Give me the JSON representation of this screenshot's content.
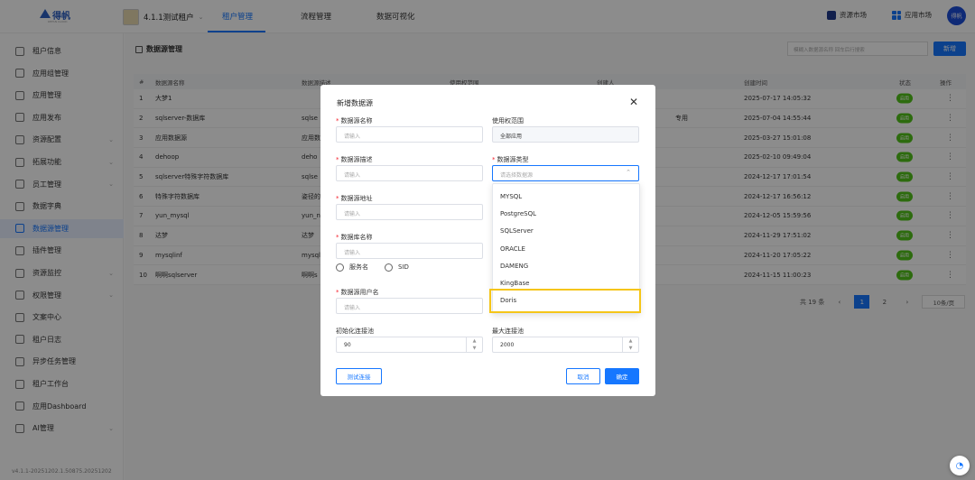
{
  "brand": {
    "name": "得帆",
    "sub": "DEFAN CLOUD",
    "color": "#2d5fc4"
  },
  "tenant": {
    "name": "4.1.1测试租户"
  },
  "nav": [
    "租户管理",
    "流程管理",
    "数据可视化"
  ],
  "topright": {
    "resource_market": "资源市场",
    "app_market": "应用市场",
    "user": "得帆"
  },
  "sidebar": [
    {
      "label": "租户信息",
      "icon": "building-icon"
    },
    {
      "label": "应用组管理",
      "icon": "org-icon"
    },
    {
      "label": "应用管理",
      "icon": "app-icon"
    },
    {
      "label": "应用发布",
      "icon": "publish-icon"
    },
    {
      "label": "资源配置",
      "icon": "folder-icon",
      "chevron": "⌄"
    },
    {
      "label": "拓展功能",
      "icon": "folder-icon",
      "chevron": "⌄"
    },
    {
      "label": "员工管理",
      "icon": "user-icon",
      "chevron": "⌄"
    },
    {
      "label": "数据字典",
      "icon": "book-icon"
    },
    {
      "label": "数据源管理",
      "icon": "database-icon",
      "active": true
    },
    {
      "label": "插件管理",
      "icon": "plugin-icon"
    },
    {
      "label": "资源监控",
      "icon": "folder-icon",
      "chevron": "⌄"
    },
    {
      "label": "权限管理",
      "icon": "shield-icon",
      "chevron": "⌄"
    },
    {
      "label": "文案中心",
      "icon": "globe-icon"
    },
    {
      "label": "租户日志",
      "icon": "log-icon"
    },
    {
      "label": "异步任务管理",
      "icon": "task-icon"
    },
    {
      "label": "租户工作台",
      "icon": "workbench-icon"
    },
    {
      "label": "应用Dashboard",
      "icon": "dashboard-icon"
    },
    {
      "label": "AI管理",
      "icon": "ai-icon",
      "chevron": "⌄"
    }
  ],
  "version": "v4.1.1-20251202.1.50875.20251202",
  "page": {
    "title": "数据源管理",
    "search_placeholder": "模糊入数据源名称  回车后行搜索",
    "new_btn": "新增"
  },
  "table": {
    "headers": [
      "#",
      "数据源名称",
      "数据源描述",
      "使用权范围",
      "创建人",
      "创建时间",
      "状态",
      "操作"
    ],
    "rows": [
      {
        "no": "1",
        "name": "大梦1",
        "desc": "",
        "time": "2025-07-17 14:05:32",
        "status": "启用"
      },
      {
        "no": "2",
        "name": "sqlserver-数据库",
        "desc": "sqlse",
        "extra": "专用",
        "time": "2025-07-04 14:55:44",
        "status": "启用"
      },
      {
        "no": "3",
        "name": "应用数据源",
        "desc": "应用数",
        "time": "2025-03-27 15:01:08",
        "status": "启用"
      },
      {
        "no": "4",
        "name": "dehoop",
        "desc": "deho",
        "time": "2025-02-10 09:49:04",
        "status": "启用"
      },
      {
        "no": "5",
        "name": "sqlserver特殊字符数据库",
        "desc": "sqlse",
        "time": "2024-12-17 17:01:54",
        "status": "启用"
      },
      {
        "no": "6",
        "name": "特殊字符数据库",
        "desc": "姿径的",
        "time": "2024-12-17 16:56:12",
        "status": "启用"
      },
      {
        "no": "7",
        "name": "yun_mysql",
        "desc": "yun_n",
        "time": "2024-12-05 15:59:56",
        "status": "启用"
      },
      {
        "no": "8",
        "name": "达梦",
        "desc": "达梦",
        "time": "2024-11-29 17:51:02",
        "status": "启用"
      },
      {
        "no": "9",
        "name": "mysqlinf",
        "desc": "mysql",
        "time": "2024-11-20 17:05:22",
        "status": "启用"
      },
      {
        "no": "10",
        "name": "啊啊sqlserver",
        "desc": "啊啊s",
        "time": "2024-11-15 11:00:23",
        "status": "启用"
      }
    ]
  },
  "pagination": {
    "total": "共 19 条",
    "prev": "‹",
    "pages": [
      "1",
      "2"
    ],
    "next": "›",
    "size": "10条/页"
  },
  "modal": {
    "title": "新增数据源",
    "close": "✕",
    "fields": {
      "name": {
        "label": "数据源名称",
        "placeholder": "请输入"
      },
      "scope": {
        "label": "使用权范围",
        "value": "全部应用"
      },
      "desc": {
        "label": "数据源描述",
        "placeholder": "请输入"
      },
      "type": {
        "label": "数据源类型",
        "placeholder": "请选择数据源"
      },
      "addr": {
        "label": "数据源地址",
        "placeholder": "请输入"
      },
      "db": {
        "label": "数据库名称",
        "placeholder": "请输入"
      },
      "user": {
        "label": "数据源用户名",
        "placeholder": "请输入"
      },
      "init_pool": {
        "label": "初始化连接池",
        "value": "90"
      },
      "max_pool": {
        "label": "最大连接池",
        "value": "2000"
      }
    },
    "radio": {
      "service": "服务名",
      "sid": "SID"
    },
    "type_options": [
      "MYSQL",
      "PostgreSQL",
      "SQLServer",
      "ORACLE",
      "DAMENG",
      "KingBase",
      "Doris"
    ],
    "buttons": {
      "test": "测试连接",
      "cancel": "取消",
      "ok": "确定"
    }
  }
}
